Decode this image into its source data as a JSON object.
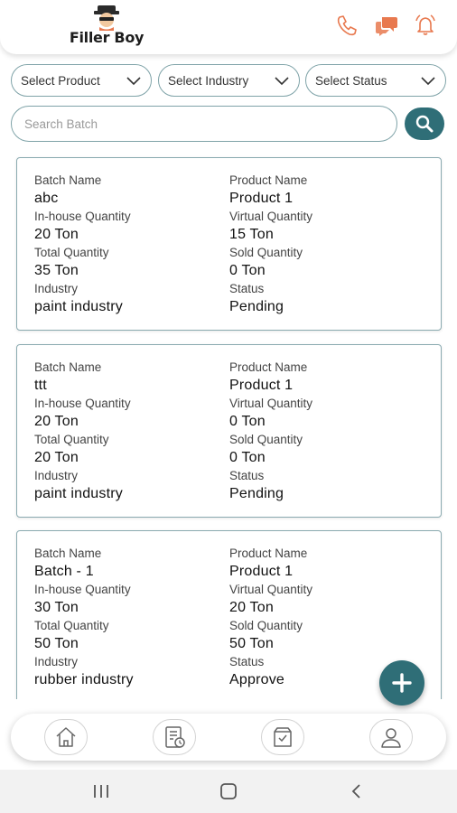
{
  "header": {
    "logo_text": "Filler Boy",
    "icons": [
      "phone-icon",
      "chat-icon",
      "bell-icon"
    ],
    "accent": "#e8794f"
  },
  "filters": {
    "product": "Select Product",
    "industry": "Select Industry",
    "status": "Select Status"
  },
  "search": {
    "placeholder": "Search Batch"
  },
  "cards": [
    {
      "batch_label": "Batch Name",
      "batch": "abc",
      "product_label": "Product Name",
      "product": "Product 1",
      "inhouse_label": "In-house Quantity",
      "inhouse": "20 Ton",
      "virtual_label": "Virtual Quantity",
      "virtual": "15 Ton",
      "total_label": "Total Quantity",
      "total": "35 Ton",
      "sold_label": "Sold Quantity",
      "sold": "0 Ton",
      "industry_label": "Industry",
      "industry": "paint industry",
      "status_label": "Status",
      "status": "Pending"
    },
    {
      "batch_label": "Batch Name",
      "batch": "ttt",
      "product_label": "Product Name",
      "product": "Product 1",
      "inhouse_label": "In-house Quantity",
      "inhouse": "20 Ton",
      "virtual_label": "Virtual Quantity",
      "virtual": "0 Ton",
      "total_label": "Total Quantity",
      "total": "20 Ton",
      "sold_label": "Sold Quantity",
      "sold": "0 Ton",
      "industry_label": "Industry",
      "industry": "paint industry",
      "status_label": "Status",
      "status": "Pending"
    },
    {
      "batch_label": "Batch Name",
      "batch": "Batch - 1",
      "product_label": "Product Name",
      "product": "Product 1",
      "inhouse_label": "In-house Quantity",
      "inhouse": "30 Ton",
      "virtual_label": "Virtual Quantity",
      "virtual": "20 Ton",
      "total_label": "Total Quantity",
      "total": "50 Ton",
      "sold_label": "Sold Quantity",
      "sold": "50 Ton",
      "industry_label": "Industry",
      "industry": "rubber industry",
      "status_label": "Status",
      "status": "Approve"
    }
  ],
  "bottom_nav": [
    "home-icon",
    "invoice-icon",
    "orders-box-icon",
    "profile-icon"
  ],
  "theme": {
    "primary": "#2f6e77",
    "border": "#8aaab0"
  }
}
